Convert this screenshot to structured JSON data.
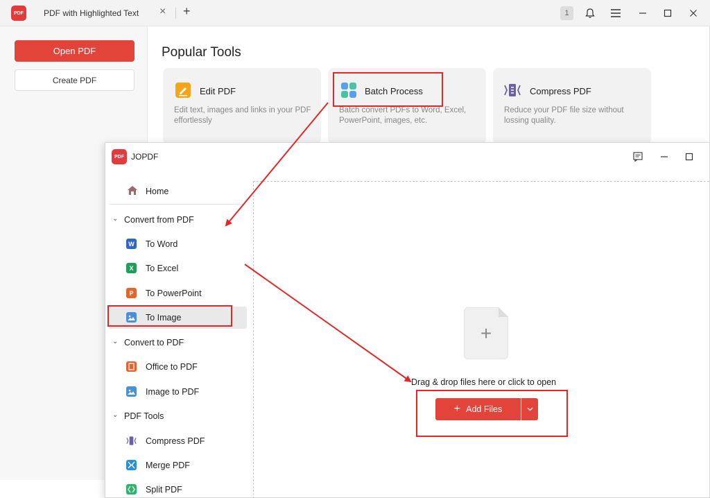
{
  "back_window": {
    "tab_title": "PDF with Highlighted Text",
    "tab_close_icon": "×",
    "tab_add_icon": "+",
    "badge_count": "1",
    "sidebar": {
      "open_pdf": "Open PDF",
      "create_pdf": "Create PDF"
    },
    "popular_tools": {
      "title": "Popular Tools",
      "cards": [
        {
          "name": "Edit PDF",
          "desc": "Edit text, images and links in your PDF effortlessly"
        },
        {
          "name": "Batch Process",
          "desc": "Batch convert PDFs to Word, Excel, PowerPoint, images, etc."
        },
        {
          "name": "Compress PDF",
          "desc": "Reduce your PDF file size without lossing quality."
        }
      ]
    }
  },
  "front_window": {
    "title": "JOPDF",
    "nav": {
      "home": "Home",
      "sections": [
        {
          "label": "Convert from PDF",
          "items": [
            "To Word",
            "To Excel",
            "To PowerPoint",
            "To Image"
          ]
        },
        {
          "label": "Convert to PDF",
          "items": [
            "Office to PDF",
            "Image to PDF"
          ]
        },
        {
          "label": "PDF Tools",
          "items": [
            "Compress PDF",
            "Merge PDF",
            "Split PDF"
          ]
        }
      ],
      "active_item": "To Image"
    },
    "drop_zone": {
      "text": "Drag & drop files here or click to open",
      "add_files": "Add Files"
    }
  },
  "logo_text": "PDF",
  "icon_letters": {
    "word": "W",
    "excel": "X",
    "powerpoint": "P"
  },
  "colors": {
    "accent": "#e2443a",
    "highlight": "#e32626"
  }
}
